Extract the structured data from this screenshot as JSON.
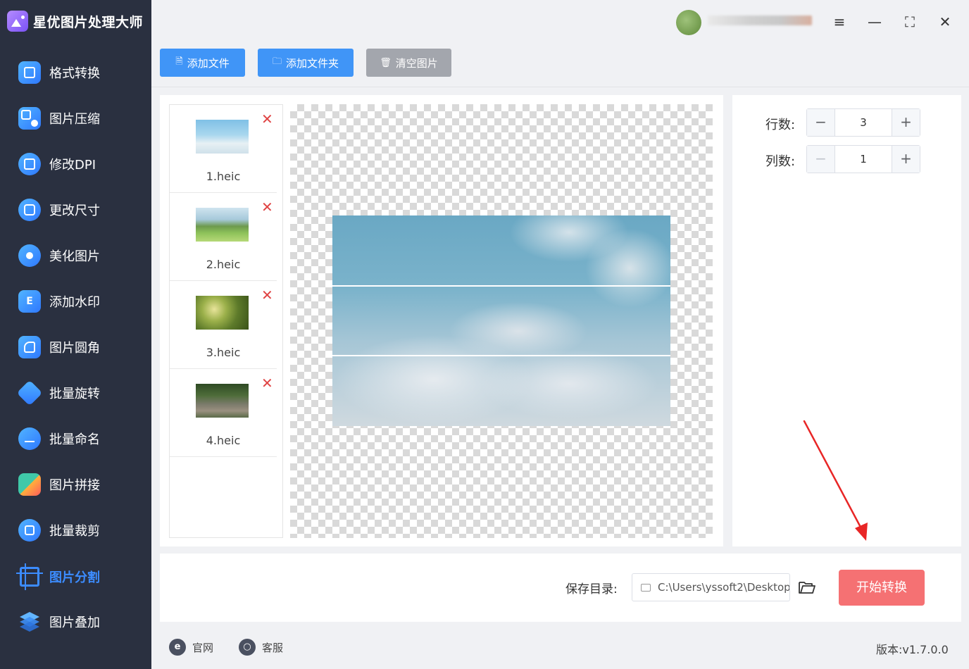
{
  "app": {
    "title": "星优图片处理大师"
  },
  "sidebar": {
    "items": [
      {
        "label": "格式转换"
      },
      {
        "label": "图片压缩"
      },
      {
        "label": "修改DPI"
      },
      {
        "label": "更改尺寸"
      },
      {
        "label": "美化图片"
      },
      {
        "label": "添加水印",
        "icon_text": "E"
      },
      {
        "label": "图片圆角"
      },
      {
        "label": "批量旋转"
      },
      {
        "label": "批量命名"
      },
      {
        "label": "图片拼接"
      },
      {
        "label": "批量裁剪"
      },
      {
        "label": "图片分割",
        "active": true
      },
      {
        "label": "图片叠加"
      }
    ]
  },
  "window_controls": {
    "settings": "≡",
    "minimize": "—",
    "maximize": "⛶",
    "close": "✕"
  },
  "toolbar": {
    "add_file_label": "添加文件",
    "add_folder_label": "添加文件夹",
    "clear_label": "清空图片"
  },
  "files": [
    {
      "name": "1.heic"
    },
    {
      "name": "2.heic"
    },
    {
      "name": "3.heic"
    },
    {
      "name": "4.heic"
    }
  ],
  "settings": {
    "rows_label": "行数:",
    "rows_value": "3",
    "cols_label": "列数:",
    "cols_value": "1",
    "minus": "−",
    "plus": "+"
  },
  "output": {
    "save_dir_label": "保存目录:",
    "save_dir_value": "C:\\Users\\yssoft2\\Desktop",
    "start_label": "开始转换"
  },
  "footer": {
    "website_label": "官网",
    "support_label": "客服",
    "version": "版本:v1.7.0.0"
  },
  "colors": {
    "sidebar_bg": "#2a3040",
    "accent_blue": "#4095f7",
    "active_nav": "#3c8cff",
    "start_button": "#f57173",
    "clear_button": "#a3a6ad",
    "delete_red": "#e04444"
  }
}
